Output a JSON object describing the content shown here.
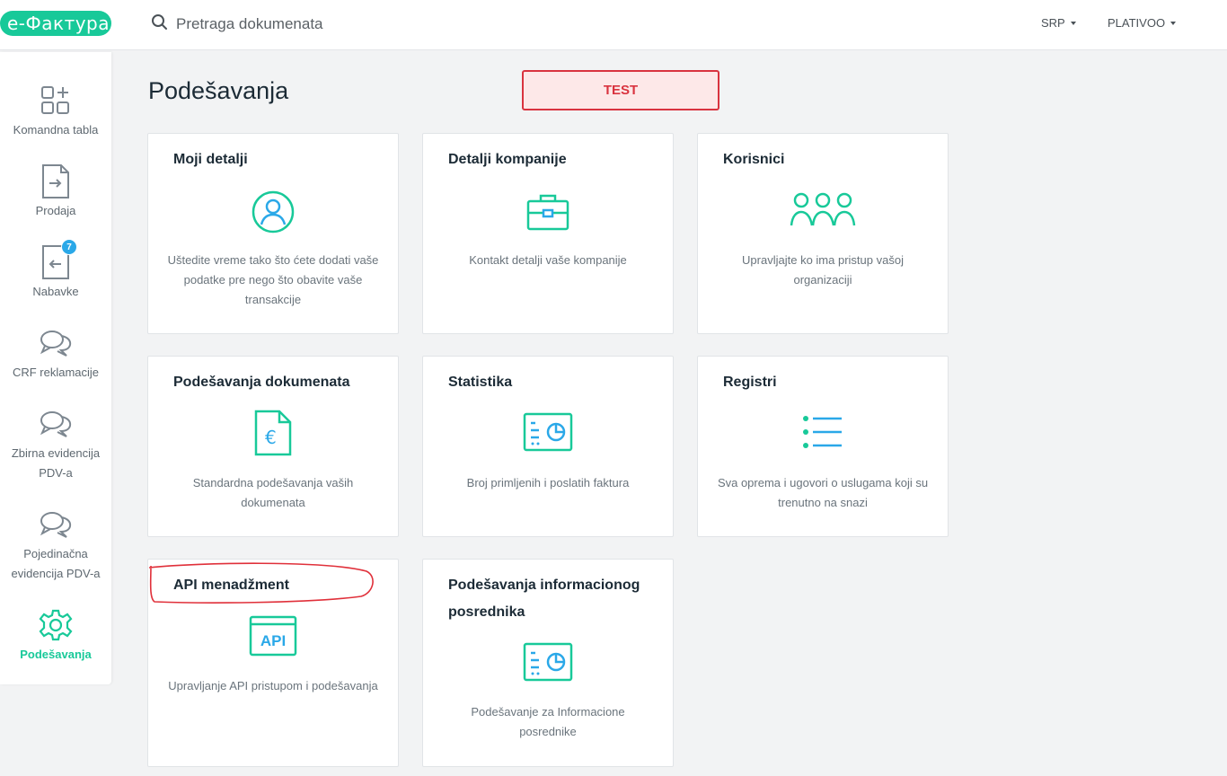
{
  "app": {
    "logo_text": "e-Фактура",
    "brand_color": "#18c999",
    "accent_blue": "#2aa8e8"
  },
  "header": {
    "search_placeholder": "Pretraga dokumenata",
    "language": "SRP",
    "company": "PLATIVOO"
  },
  "sidebar": {
    "items": [
      {
        "label": "Komandna tabla",
        "icon": "dashboard-icon"
      },
      {
        "label": "Prodaja",
        "icon": "document-arrow-right-icon"
      },
      {
        "label": "Nabavke",
        "icon": "document-arrow-left-icon",
        "badge": "7"
      },
      {
        "label": "CRF reklamacije",
        "icon": "chat-bubbles-icon"
      },
      {
        "label": "Zbirna evidencija PDV-a",
        "icon": "chat-bubbles-icon"
      },
      {
        "label": "Pojedinačna evidencija PDV-a",
        "icon": "chat-bubbles-icon"
      },
      {
        "label": "Podešavanja",
        "icon": "gear-icon",
        "active": true
      }
    ]
  },
  "main": {
    "title": "Podešavanja",
    "test_label": "TEST",
    "cards": [
      {
        "title": "Moji detalji",
        "icon": "user-circle-icon",
        "description": "Uštedite vreme tako što ćete dodati vaše podatke pre nego što obavite vaše transakcije"
      },
      {
        "title": "Detalji kompanije",
        "icon": "briefcase-icon",
        "description": "Kontakt detalji vaše kompanije"
      },
      {
        "title": "Korisnici",
        "icon": "users-icon",
        "description": "Upravljajte ko ima pristup vašoj organizaciji"
      },
      {
        "title": "Podešavanja dokumenata",
        "icon": "euro-document-icon",
        "description": "Standardna podešavanja vaših dokumenata"
      },
      {
        "title": "Statistika",
        "icon": "statistics-icon",
        "description": "Broj primljenih i poslatih faktura"
      },
      {
        "title": "Registri",
        "icon": "list-icon",
        "description": "Sva oprema i ugovori o uslugama koji su trenutno na snazi"
      },
      {
        "title": "API menadžment",
        "icon": "api-icon",
        "api_label": "API",
        "description": "Upravljanje API pristupom i podešavanja"
      },
      {
        "title": "Podešavanja informacionog posrednika",
        "icon": "statistics-icon",
        "description": "Podešavanje za Informacione posrednike"
      }
    ]
  }
}
